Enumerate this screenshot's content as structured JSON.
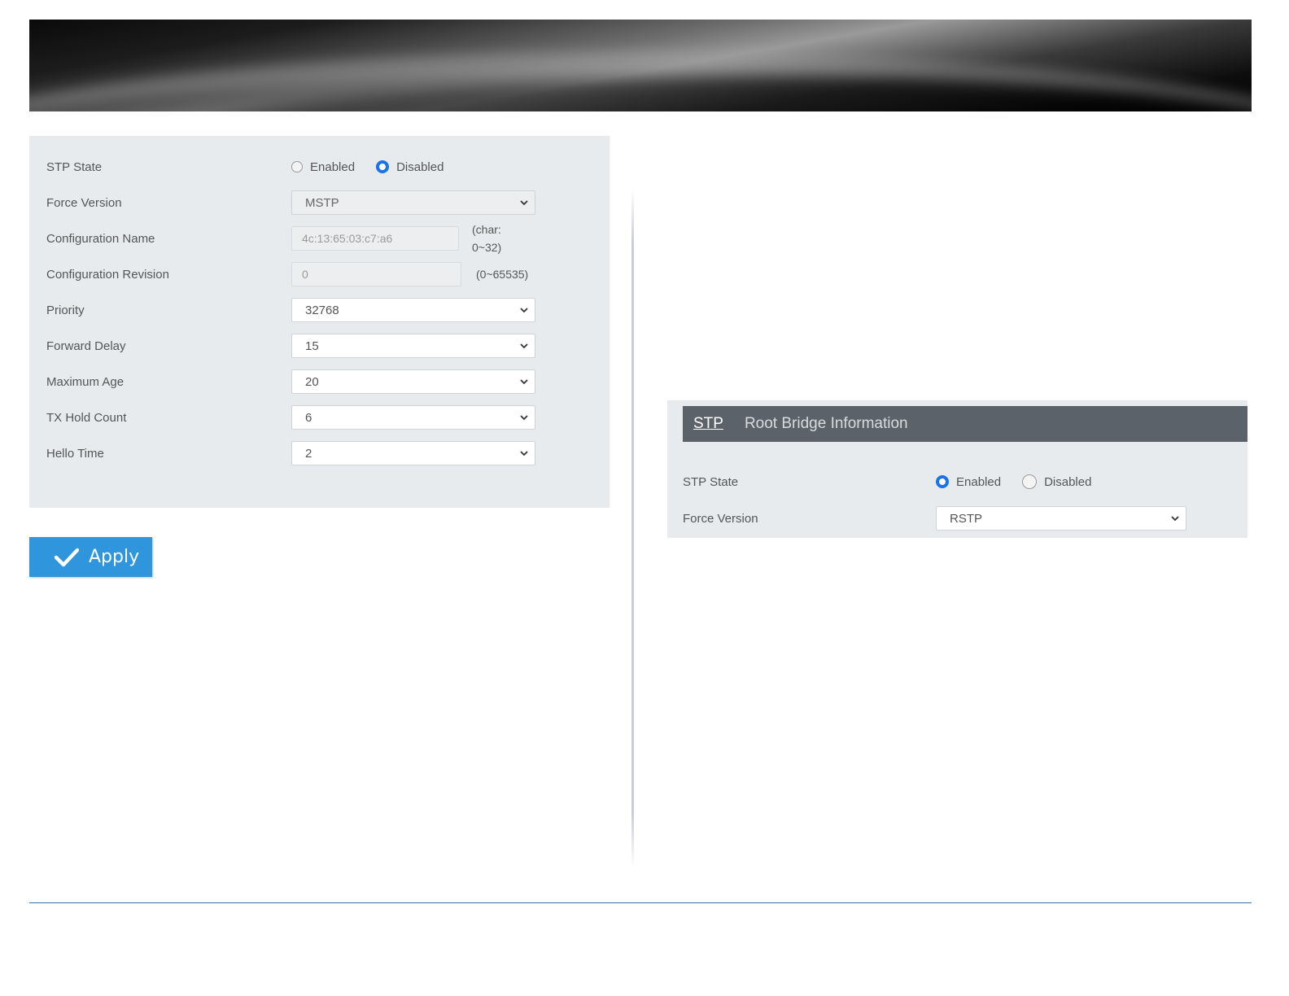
{
  "left_panel": {
    "stp_state": {
      "label": "STP State",
      "options": [
        "Enabled",
        "Disabled"
      ],
      "selected": "Disabled"
    },
    "force_version": {
      "label": "Force Version",
      "value": "MSTP"
    },
    "configuration_name": {
      "label": "Configuration Name",
      "value": "4c:13:65:03:c7:a6",
      "hint_line1": "(char:",
      "hint_line2": "0~32)"
    },
    "configuration_revision": {
      "label": "Configuration Revision",
      "value": "0",
      "hint": "(0~65535)"
    },
    "priority": {
      "label": "Priority",
      "value": "32768"
    },
    "forward_delay": {
      "label": "Forward Delay",
      "value": "15"
    },
    "maximum_age": {
      "label": "Maximum Age",
      "value": "20"
    },
    "tx_hold_count": {
      "label": "TX Hold Count",
      "value": "6"
    },
    "hello_time": {
      "label": "Hello Time",
      "value": "2"
    }
  },
  "apply_button": {
    "label": "Apply"
  },
  "right_panel": {
    "header": {
      "tab_active": "STP",
      "tab_title": "Root Bridge Information"
    },
    "stp_state": {
      "label": "STP State",
      "options": [
        "Enabled",
        "Disabled"
      ],
      "selected": "Enabled"
    },
    "force_version": {
      "label": "Force Version",
      "value": "RSTP"
    }
  },
  "colors": {
    "accent": "#1a73e8",
    "apply": "#2f95dc",
    "panel": "#e8ebee",
    "header": "#5c626a",
    "rule": "#3b6fb6"
  },
  "icons": {
    "select_arrow": "chevron-down-icon",
    "apply": "checkmark-icon"
  }
}
